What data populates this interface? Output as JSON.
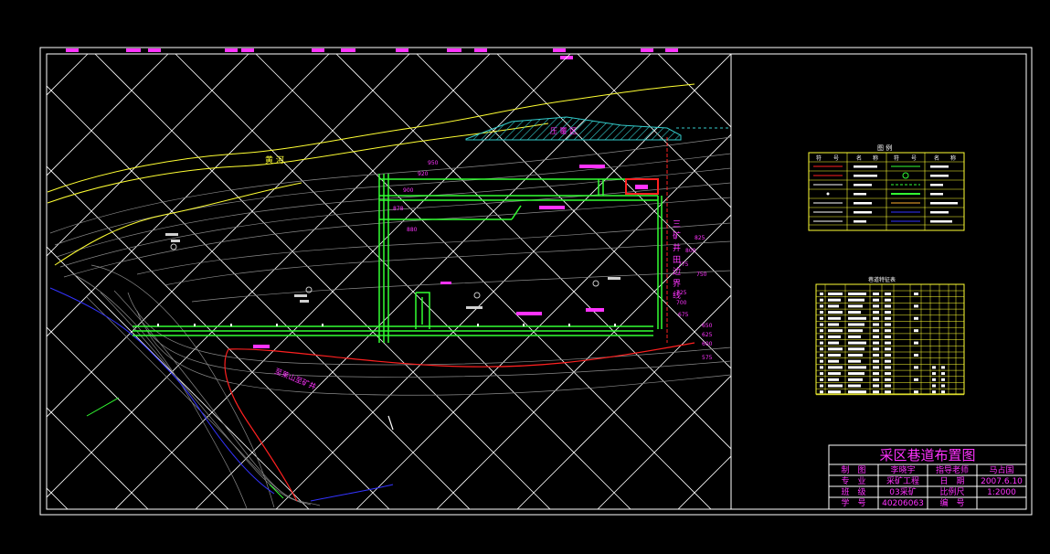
{
  "drawing": {
    "title": "采区巷道布置图",
    "labels": {
      "river": "黄 河",
      "hatch_zone": "压 覆 区",
      "road": "至莱山至矿井",
      "boundary_chars": [
        "三",
        "矿",
        "井",
        "田",
        "边",
        "界",
        "线"
      ]
    },
    "elevations_top": [
      "950",
      "920",
      "900",
      "878",
      "880"
    ],
    "elevations_right": [
      "825",
      "800",
      "775",
      "750",
      "725",
      "700",
      "675",
      "650",
      "625",
      "600",
      "575"
    ]
  },
  "title_block": {
    "rows": [
      [
        "制　图",
        "李晓宇",
        "指导老师",
        "马占国"
      ],
      [
        "专　业",
        "采矿工程",
        "日　期",
        "2007.6.10"
      ],
      [
        "班　级",
        "03采矿",
        "比例尺",
        "1:2000"
      ],
      [
        "学　号",
        "40206063",
        "编　号",
        ""
      ]
    ]
  },
  "legend": {
    "title": "图 例",
    "headers": [
      "符",
      "号",
      "名",
      "称",
      "符",
      "号",
      "名",
      "称"
    ]
  },
  "table": {
    "title": "巷道特征表"
  },
  "colors": {
    "background": "#000000",
    "frame": "#ffffff",
    "grid": "#ffffff",
    "contour": "#a0a0a0",
    "roadway": "#33ff33",
    "river": "#ffff33",
    "magenta": "#ff33ff",
    "red": "#ff2020",
    "cyan": "#33cccc",
    "blue": "#3333ff"
  }
}
